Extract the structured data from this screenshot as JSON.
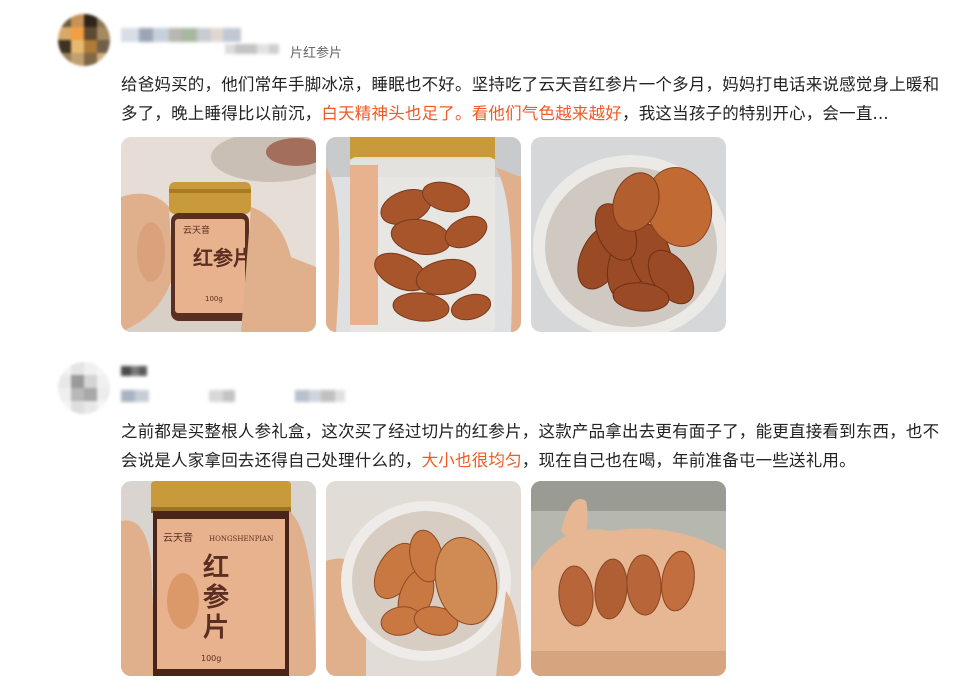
{
  "reviews": [
    {
      "meta_tag": "片红参片",
      "text_plain_1": "给爸妈买的，他们常年手脚冰凉，睡眠也不好。坚持吃了云天音红参片一个多月，妈妈打电话来说感觉身上暖和多了，晚上睡得比以前沉，",
      "text_hl_1": "白天精神头也足了。看他们气色越来越好",
      "text_plain_2": "，我这当孩子的特别开心，会一直...",
      "photos": [
        {
          "name": "jar-in-hand-photo",
          "jar_brand": "云天音",
          "jar_title": "红参片",
          "jar_weight": "100g"
        },
        {
          "name": "jar-side-slices-photo"
        },
        {
          "name": "open-jar-slices-photo"
        }
      ]
    },
    {
      "text_plain_1": "之前都是买整根人参礼盒，这次买了经过切片的红参片，这款产品拿出去更有面子了，能更直接看到东西，也不会说是人家拿回去还得自己处理什么的，",
      "text_hl_1": "大小也很均匀",
      "text_plain_2": "，现在自己也在喝，年前准备屯一些送礼用。",
      "photos": [
        {
          "name": "jar-closeup-photo",
          "jar_brand": "云天音",
          "jar_pinyin": "HONGSHENPIAN",
          "jar_title_1": "红",
          "jar_title_2": "参",
          "jar_title_3": "片",
          "jar_weight": "100g"
        },
        {
          "name": "jar-top-slices-photo"
        },
        {
          "name": "slices-on-palm-photo"
        }
      ]
    }
  ],
  "colors": {
    "highlight": "#f05a24",
    "text": "#222222",
    "jar_label": "#e9b28e",
    "lid_gold": "#c89a3c",
    "ginseng": "#a8552c"
  }
}
